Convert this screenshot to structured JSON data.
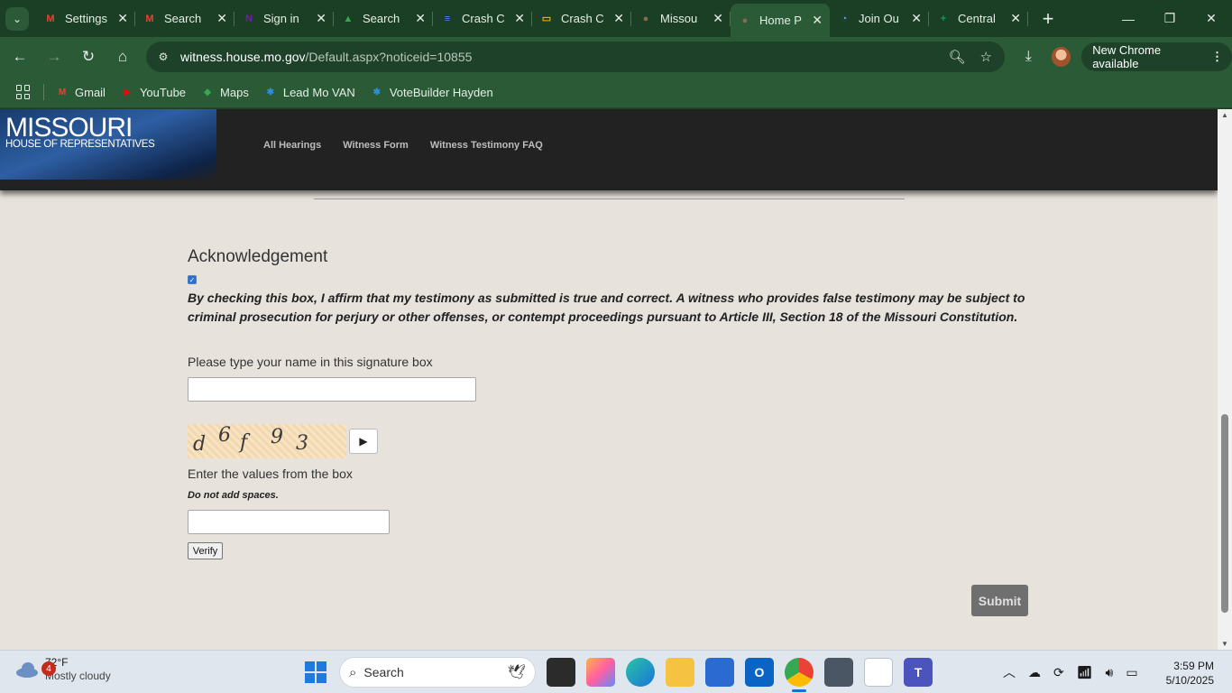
{
  "browser": {
    "tabs": [
      {
        "title": "Settings",
        "icon": "gmail-icon",
        "color": "#ea4335",
        "glyph": "M"
      },
      {
        "title": "Search",
        "icon": "gmail-icon",
        "color": "#ea4335",
        "glyph": "M"
      },
      {
        "title": "Sign in",
        "icon": "onenote-icon",
        "color": "#7719aa",
        "glyph": "N"
      },
      {
        "title": "Search",
        "icon": "google-drive-icon",
        "color": "#34a853",
        "glyph": "▲"
      },
      {
        "title": "Crash C",
        "icon": "google-docs-icon",
        "color": "#4285f4",
        "glyph": "≡"
      },
      {
        "title": "Crash C",
        "icon": "google-slides-icon",
        "color": "#f4b400",
        "glyph": "▭"
      },
      {
        "title": "Missou",
        "icon": "missouri-seal-icon",
        "color": "#8a6a4f",
        "glyph": "●"
      },
      {
        "title": "Home P",
        "icon": "missouri-seal-icon",
        "color": "#8a6a4f",
        "glyph": "●",
        "active": true
      },
      {
        "title": "Join Ou",
        "icon": "loading-icon",
        "color": "#4ea3ff",
        "glyph": "◔"
      },
      {
        "title": "Central",
        "icon": "google-sheets-icon",
        "color": "#0f9d58",
        "glyph": "+"
      }
    ],
    "url_host": "witness.house.mo.gov",
    "url_path": "/Default.aspx?noticeid=10855",
    "update_label": "New Chrome available",
    "bookmarks": [
      {
        "label": "Gmail",
        "icon": "gmail-icon",
        "color": "#ea4335",
        "glyph": "M"
      },
      {
        "label": "YouTube",
        "icon": "youtube-icon",
        "color": "#ff0000",
        "glyph": "▶"
      },
      {
        "label": "Maps",
        "icon": "maps-icon",
        "color": "#34a853",
        "glyph": "◆"
      },
      {
        "label": "Lead Mo VAN",
        "icon": "gear-icon",
        "color": "#2d8fe0",
        "glyph": "✱"
      },
      {
        "label": "VoteBuilder Hayden",
        "icon": "gear-icon",
        "color": "#2d8fe0",
        "glyph": "✱"
      }
    ]
  },
  "site": {
    "logo_line1": "MISSOURI",
    "logo_line2": "HOUSE OF REPRESENTATIVES",
    "nav": [
      "All Hearings",
      "Witness Form",
      "Witness Testimony FAQ"
    ]
  },
  "form": {
    "section_title": "Acknowledgement",
    "ack_checked": true,
    "affirm_text": "By checking this box, I affirm that my testimony as submitted is true and correct. A witness who provides false testimony may be subject to criminal prosecution for perjury or other offenses, or contempt proceedings pursuant to Article III, Section 18 of the Missouri Constitution.",
    "signature_label": "Please type your name in this signature box",
    "signature_value": "",
    "captcha_chars": [
      "d",
      "6",
      "f",
      "9",
      "3"
    ],
    "captcha_label": "Enter the values from the box",
    "captcha_hint": "Do not add spaces.",
    "captcha_value": "",
    "verify_label": "Verify",
    "submit_label": "Submit"
  },
  "taskbar": {
    "weather_badge": "4",
    "temperature": "72°F",
    "condition": "Mostly cloudy",
    "search_placeholder": "Search",
    "time": "3:59 PM",
    "date": "5/10/2025"
  }
}
